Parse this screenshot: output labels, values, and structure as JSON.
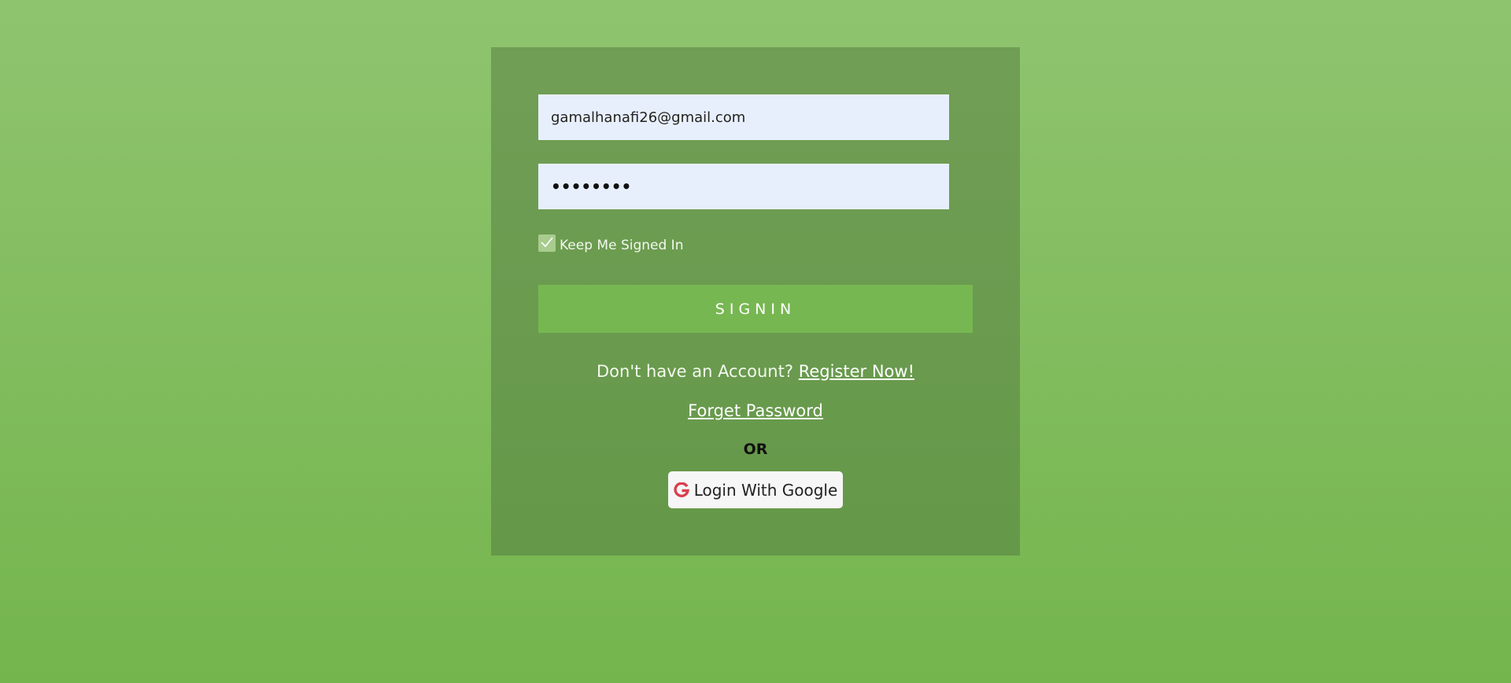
{
  "login": {
    "email_value": "gamalhanafi26@gmail.com",
    "password_value": "••••••••",
    "keep_signed_in_label": "Keep Me Signed In",
    "keep_signed_in_checked": true,
    "signin_label": "SIGNIN",
    "no_account_text": "Don't have an Account?",
    "register_link": "Register Now!",
    "forgot_link": "Forget Password",
    "or_text": "OR",
    "google_label": "Login With Google",
    "google_icon": "google-g-icon"
  },
  "colors": {
    "background_top": "#8fc46f",
    "background_bottom": "#74b54d",
    "card": "#6a9c4f",
    "input_bg": "#e8effc",
    "signin_button": "#77b752",
    "google_icon": "#d93f4f"
  }
}
